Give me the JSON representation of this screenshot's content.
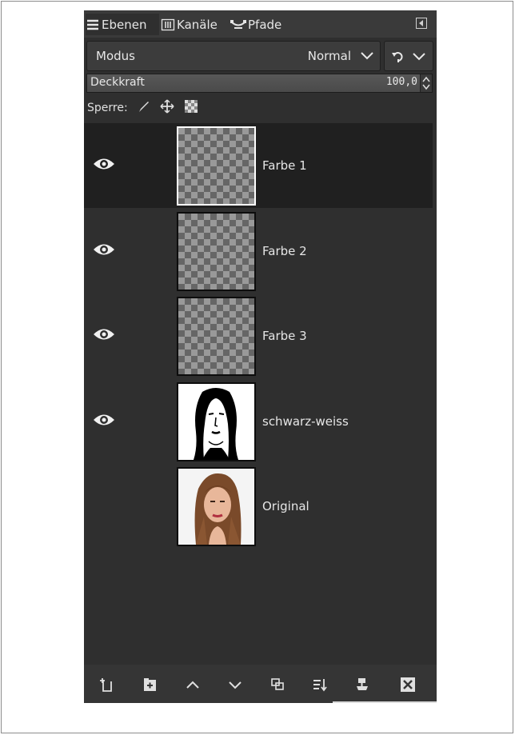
{
  "tabs": [
    {
      "label": "Ebenen",
      "icon": "layers-icon",
      "active": true
    },
    {
      "label": "Kanäle",
      "icon": "channels-icon",
      "active": false
    },
    {
      "label": "Pfade",
      "icon": "paths-icon",
      "active": false
    }
  ],
  "mode": {
    "label": "Modus",
    "value": "Normal"
  },
  "opacity": {
    "label": "Deckkraft",
    "value": "100,0",
    "fraction": 1.0
  },
  "lock": {
    "label": "Sperre:"
  },
  "layers": [
    {
      "name": "Farbe 1",
      "visible": true,
      "selected": true,
      "thumb": "transparent"
    },
    {
      "name": "Farbe 2",
      "visible": true,
      "selected": false,
      "thumb": "transparent"
    },
    {
      "name": "Farbe 3",
      "visible": true,
      "selected": false,
      "thumb": "transparent"
    },
    {
      "name": "schwarz-weiss",
      "visible": true,
      "selected": false,
      "thumb": "bw-portrait"
    },
    {
      "name": "Original",
      "visible": false,
      "selected": false,
      "thumb": "color-portrait"
    }
  ],
  "toolbar_icons": [
    "new-layer-icon",
    "new-group-icon",
    "raise-layer-icon",
    "lower-layer-icon",
    "duplicate-layer-icon",
    "merge-down-icon",
    "anchor-layer-icon",
    "delete-layer-icon"
  ],
  "colors": {
    "panel": "#2f2f2f",
    "selected_row": "#202020",
    "text": "#e6e6e6"
  }
}
